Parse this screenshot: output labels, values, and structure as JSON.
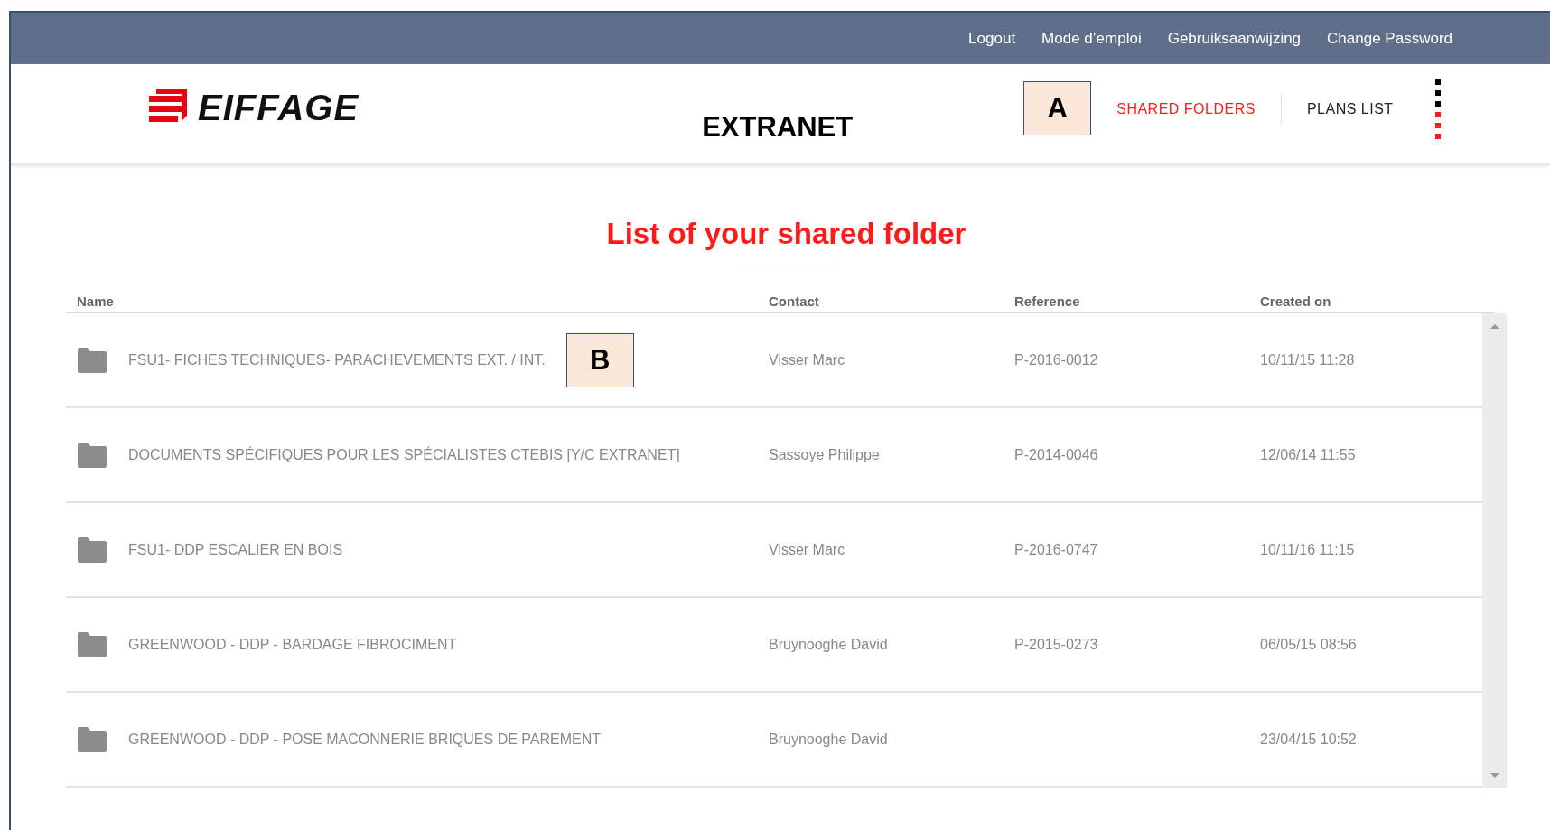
{
  "top_links": [
    "Logout",
    "Mode d’emploi",
    "Gebruiksaanwijzing",
    "Change Password"
  ],
  "logo": {
    "text": "EIFFAGE"
  },
  "app_title": "EXTRANET",
  "callouts": [
    {
      "label": "A"
    },
    {
      "label": "B"
    }
  ],
  "nav": [
    {
      "label": "SHARED FOLDERS",
      "selected": true
    },
    {
      "label": "PLANS LIST",
      "selected": false
    }
  ],
  "page_title": "List of your shared folder",
  "table": {
    "columns": [
      "Name",
      "Contact",
      "Reference",
      "Created on"
    ],
    "rows": [
      {
        "name": "FSU1- FICHES TECHNIQUES- PARACHEVEMENTS EXT. / INT.",
        "contact": "Visser Marc",
        "reference": "P-2016-0012",
        "created": "10/11/15 11:28"
      },
      {
        "name": "DOCUMENTS SPÉCIFIQUES POUR LES SPÉCIALISTES CTEBIS [Y/C EXTRANET]",
        "contact": "Sassoye Philippe",
        "reference": "P-2014-0046",
        "created": "12/06/14 11:55"
      },
      {
        "name": "FSU1- DDP ESCALIER EN BOIS",
        "contact": "Visser Marc",
        "reference": "P-2016-0747",
        "created": "10/11/16 11:15"
      },
      {
        "name": "GREENWOOD - DDP - BARDAGE FIBROCIMENT",
        "contact": "Bruynooghe David",
        "reference": "P-2015-0273",
        "created": "06/05/15 08:56"
      },
      {
        "name": "GREENWOOD - DDP - POSE MACONNERIE BRIQUES DE PAREMENT",
        "contact": "Bruynooghe David",
        "reference": "",
        "created": "23/04/15 10:52"
      }
    ]
  }
}
